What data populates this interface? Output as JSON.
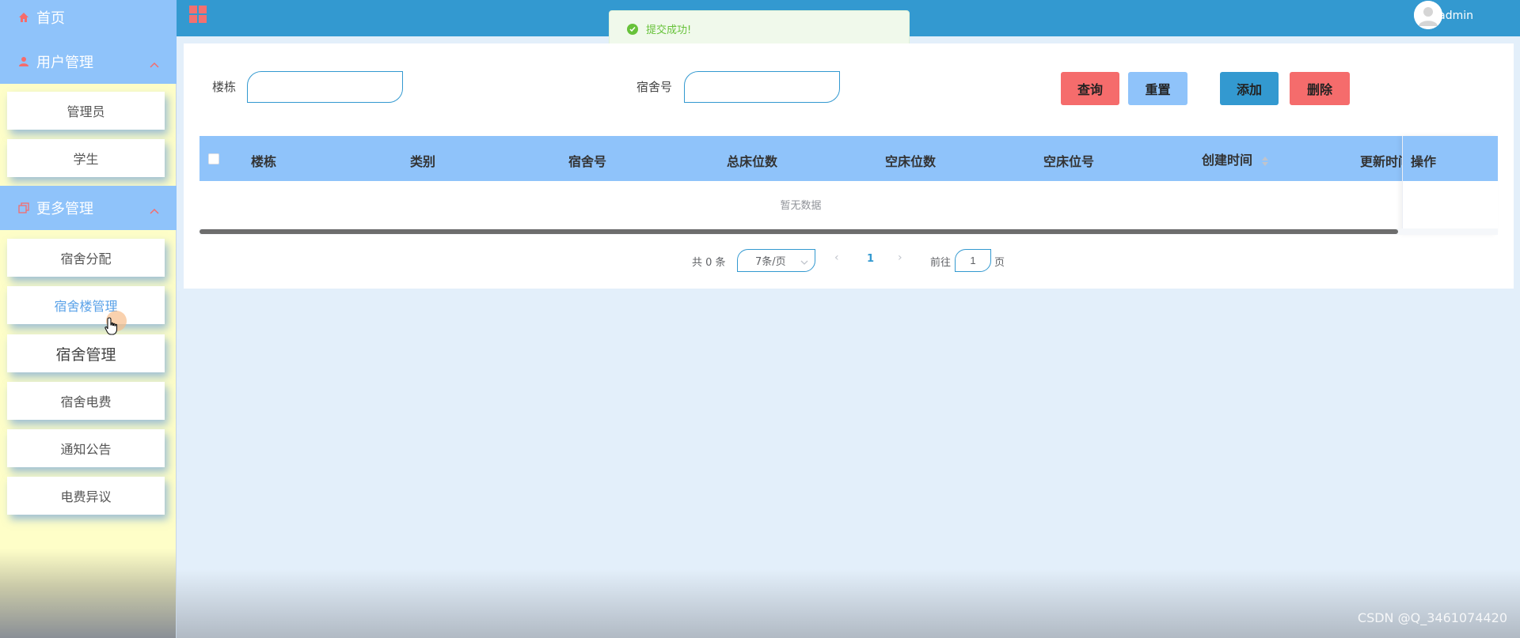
{
  "sidebar": {
    "home_label": "首页",
    "user_mgmt_label": "用户管理",
    "user_items": [
      "管理员",
      "学生"
    ],
    "more_mgmt_label": "更多管理",
    "more_items": [
      "宿舍分配",
      "宿舍楼管理",
      "宿舍管理",
      "宿舍电费",
      "通知公告",
      "电费异议"
    ],
    "active_item": "宿舍楼管理"
  },
  "topbar": {
    "username": "admin"
  },
  "toast": {
    "message": "提交成功!"
  },
  "search": {
    "building_label": "楼栋",
    "building_value": "",
    "room_label": "宿舍号",
    "room_value": "",
    "query_label": "查询",
    "reset_label": "重置",
    "add_label": "添加",
    "delete_label": "删除"
  },
  "table": {
    "columns": [
      "楼栋",
      "类别",
      "宿舍号",
      "总床位数",
      "空床位数",
      "空床位号",
      "创建时间",
      "更新时间",
      "操作"
    ],
    "empty_text": "暂无数据"
  },
  "pagination": {
    "total_text": "共 0 条",
    "page_size": "7条/页",
    "current_page": "1",
    "goto_label": "前往",
    "goto_value": "1",
    "page_suffix": "页"
  },
  "watermark": "CSDN @Q_3461074420",
  "colors": {
    "primary": "#3399d0",
    "light_blue": "#8fc3fa",
    "danger": "#f56c6c",
    "success": "#67c23a",
    "sidebar_bg": "#fefec8"
  }
}
